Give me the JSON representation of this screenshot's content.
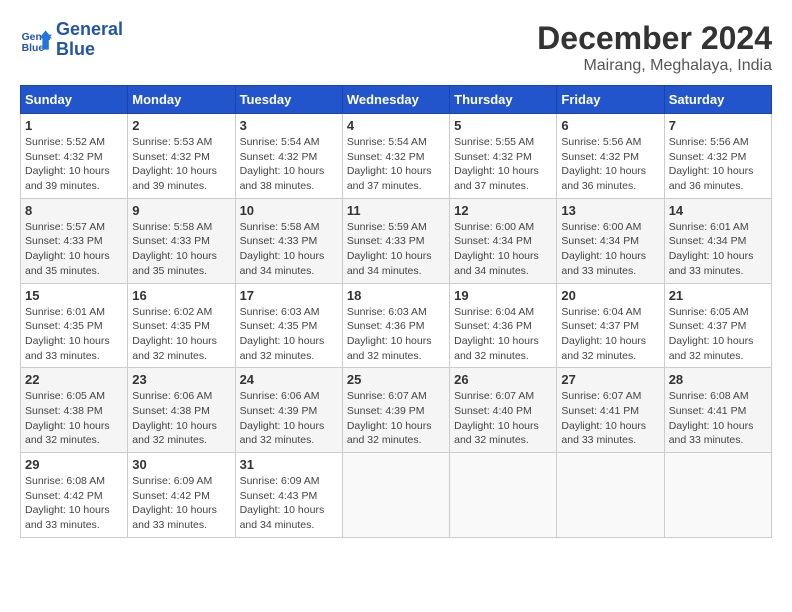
{
  "logo": {
    "line1": "General",
    "line2": "Blue"
  },
  "title": "December 2024",
  "location": "Mairang, Meghalaya, India",
  "headers": [
    "Sunday",
    "Monday",
    "Tuesday",
    "Wednesday",
    "Thursday",
    "Friday",
    "Saturday"
  ],
  "weeks": [
    [
      {
        "day": "1",
        "info": "Sunrise: 5:52 AM\nSunset: 4:32 PM\nDaylight: 10 hours\nand 39 minutes."
      },
      {
        "day": "2",
        "info": "Sunrise: 5:53 AM\nSunset: 4:32 PM\nDaylight: 10 hours\nand 39 minutes."
      },
      {
        "day": "3",
        "info": "Sunrise: 5:54 AM\nSunset: 4:32 PM\nDaylight: 10 hours\nand 38 minutes."
      },
      {
        "day": "4",
        "info": "Sunrise: 5:54 AM\nSunset: 4:32 PM\nDaylight: 10 hours\nand 37 minutes."
      },
      {
        "day": "5",
        "info": "Sunrise: 5:55 AM\nSunset: 4:32 PM\nDaylight: 10 hours\nand 37 minutes."
      },
      {
        "day": "6",
        "info": "Sunrise: 5:56 AM\nSunset: 4:32 PM\nDaylight: 10 hours\nand 36 minutes."
      },
      {
        "day": "7",
        "info": "Sunrise: 5:56 AM\nSunset: 4:32 PM\nDaylight: 10 hours\nand 36 minutes."
      }
    ],
    [
      {
        "day": "8",
        "info": "Sunrise: 5:57 AM\nSunset: 4:33 PM\nDaylight: 10 hours\nand 35 minutes."
      },
      {
        "day": "9",
        "info": "Sunrise: 5:58 AM\nSunset: 4:33 PM\nDaylight: 10 hours\nand 35 minutes."
      },
      {
        "day": "10",
        "info": "Sunrise: 5:58 AM\nSunset: 4:33 PM\nDaylight: 10 hours\nand 34 minutes."
      },
      {
        "day": "11",
        "info": "Sunrise: 5:59 AM\nSunset: 4:33 PM\nDaylight: 10 hours\nand 34 minutes."
      },
      {
        "day": "12",
        "info": "Sunrise: 6:00 AM\nSunset: 4:34 PM\nDaylight: 10 hours\nand 34 minutes."
      },
      {
        "day": "13",
        "info": "Sunrise: 6:00 AM\nSunset: 4:34 PM\nDaylight: 10 hours\nand 33 minutes."
      },
      {
        "day": "14",
        "info": "Sunrise: 6:01 AM\nSunset: 4:34 PM\nDaylight: 10 hours\nand 33 minutes."
      }
    ],
    [
      {
        "day": "15",
        "info": "Sunrise: 6:01 AM\nSunset: 4:35 PM\nDaylight: 10 hours\nand 33 minutes."
      },
      {
        "day": "16",
        "info": "Sunrise: 6:02 AM\nSunset: 4:35 PM\nDaylight: 10 hours\nand 32 minutes."
      },
      {
        "day": "17",
        "info": "Sunrise: 6:03 AM\nSunset: 4:35 PM\nDaylight: 10 hours\nand 32 minutes."
      },
      {
        "day": "18",
        "info": "Sunrise: 6:03 AM\nSunset: 4:36 PM\nDaylight: 10 hours\nand 32 minutes."
      },
      {
        "day": "19",
        "info": "Sunrise: 6:04 AM\nSunset: 4:36 PM\nDaylight: 10 hours\nand 32 minutes."
      },
      {
        "day": "20",
        "info": "Sunrise: 6:04 AM\nSunset: 4:37 PM\nDaylight: 10 hours\nand 32 minutes."
      },
      {
        "day": "21",
        "info": "Sunrise: 6:05 AM\nSunset: 4:37 PM\nDaylight: 10 hours\nand 32 minutes."
      }
    ],
    [
      {
        "day": "22",
        "info": "Sunrise: 6:05 AM\nSunset: 4:38 PM\nDaylight: 10 hours\nand 32 minutes."
      },
      {
        "day": "23",
        "info": "Sunrise: 6:06 AM\nSunset: 4:38 PM\nDaylight: 10 hours\nand 32 minutes."
      },
      {
        "day": "24",
        "info": "Sunrise: 6:06 AM\nSunset: 4:39 PM\nDaylight: 10 hours\nand 32 minutes."
      },
      {
        "day": "25",
        "info": "Sunrise: 6:07 AM\nSunset: 4:39 PM\nDaylight: 10 hours\nand 32 minutes."
      },
      {
        "day": "26",
        "info": "Sunrise: 6:07 AM\nSunset: 4:40 PM\nDaylight: 10 hours\nand 32 minutes."
      },
      {
        "day": "27",
        "info": "Sunrise: 6:07 AM\nSunset: 4:41 PM\nDaylight: 10 hours\nand 33 minutes."
      },
      {
        "day": "28",
        "info": "Sunrise: 6:08 AM\nSunset: 4:41 PM\nDaylight: 10 hours\nand 33 minutes."
      }
    ],
    [
      {
        "day": "29",
        "info": "Sunrise: 6:08 AM\nSunset: 4:42 PM\nDaylight: 10 hours\nand 33 minutes."
      },
      {
        "day": "30",
        "info": "Sunrise: 6:09 AM\nSunset: 4:42 PM\nDaylight: 10 hours\nand 33 minutes."
      },
      {
        "day": "31",
        "info": "Sunrise: 6:09 AM\nSunset: 4:43 PM\nDaylight: 10 hours\nand 34 minutes."
      },
      {
        "day": "",
        "info": ""
      },
      {
        "day": "",
        "info": ""
      },
      {
        "day": "",
        "info": ""
      },
      {
        "day": "",
        "info": ""
      }
    ]
  ]
}
